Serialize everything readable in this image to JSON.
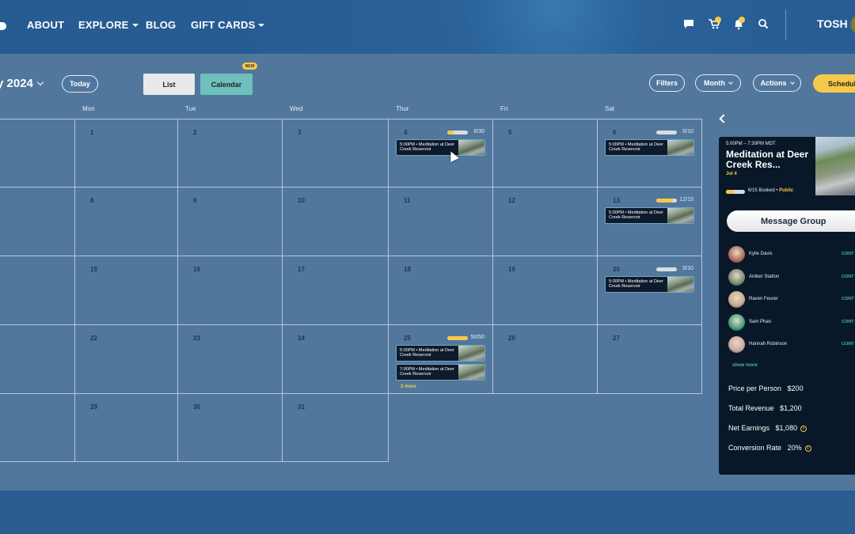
{
  "nav": {
    "items": [
      {
        "label": "ABOUT",
        "has_dropdown": false
      },
      {
        "label": "EXPLORE",
        "has_dropdown": true
      },
      {
        "label": "BLOG",
        "has_dropdown": false
      },
      {
        "label": "GIFT CARDS",
        "has_dropdown": true
      }
    ],
    "icons": [
      "chat-icon",
      "cart-icon",
      "bell-icon",
      "search-icon"
    ],
    "user_name": "TOSH"
  },
  "toolbar": {
    "month_label": "y 2024",
    "today_label": "Today",
    "list_label": "List",
    "calendar_label": "Calendar",
    "new_badge": "NEW",
    "filters_label": "Filters",
    "view_select": "Month",
    "actions_label": "Actions",
    "schedule_label": "Schedul"
  },
  "calendar": {
    "days_of_week": [
      "",
      "Mon",
      "Tue",
      "Wed",
      "Thur",
      "Fri",
      "Sat"
    ],
    "weeks": [
      [
        {
          "day": ""
        },
        {
          "day": "1"
        },
        {
          "day": "2"
        },
        {
          "day": "3"
        },
        {
          "day": "4",
          "capacity": "6/30",
          "fill": 0.2,
          "events": [
            "5:00PM • Meditation at Deer Creek Reservoir"
          ]
        },
        {
          "day": "5"
        },
        {
          "day": "6",
          "capacity": "0/10",
          "fill": 0,
          "events": [
            "5:00PM • Meditation at Deer Creek Reservoir"
          ]
        }
      ],
      [
        {
          "day": ""
        },
        {
          "day": "8"
        },
        {
          "day": "9"
        },
        {
          "day": "10"
        },
        {
          "day": "11"
        },
        {
          "day": "12"
        },
        {
          "day": "13",
          "capacity": "12/15",
          "fill": 0.8,
          "events": [
            "5:00PM • Meditation at Deer Creek Reservoir"
          ]
        }
      ],
      [
        {
          "day": ""
        },
        {
          "day": "15"
        },
        {
          "day": "16"
        },
        {
          "day": "17"
        },
        {
          "day": "18"
        },
        {
          "day": "19"
        },
        {
          "day": "20",
          "capacity": "0/10",
          "fill": 0,
          "events": [
            "5:00PM • Meditation at Deer Creek Reservoir"
          ]
        }
      ],
      [
        {
          "day": ""
        },
        {
          "day": "22"
        },
        {
          "day": "23"
        },
        {
          "day": "24"
        },
        {
          "day": "25",
          "capacity": "50/50",
          "fill": 1.0,
          "events": [
            "5:00PM • Meditation at Deer Creek Reservoir",
            "7:00PM • Meditation at Deer Creek Reservoir"
          ],
          "more": "2 more"
        },
        {
          "day": "26"
        },
        {
          "day": "27"
        }
      ],
      [
        {
          "day": ""
        },
        {
          "day": "29"
        },
        {
          "day": "30"
        },
        {
          "day": "31"
        }
      ]
    ]
  },
  "panel": {
    "time": "5:00PM – 7:30PM  MDT",
    "title": "Meditation at Deer Creek Res...",
    "date": "Jul 4",
    "booked": "6/15 Booked",
    "booked_fill": 0.4,
    "visibility": "Public",
    "message_button": "Message Group",
    "attendees": [
      {
        "name": "Kylie Davis",
        "action": "CONT",
        "color": "#b06a5a"
      },
      {
        "name": "Amber Statton",
        "action": "CONT",
        "color": "#7a8a70"
      },
      {
        "name": "Raven Feurer",
        "action": "CONT",
        "color": "#c9a890"
      },
      {
        "name": "Sam Phan",
        "action": "CONT",
        "color": "#3fa07a"
      },
      {
        "name": "Hannah Robinson",
        "action": "CONT",
        "color": "#c8a8a0"
      }
    ],
    "show_more": "show more",
    "stats": [
      {
        "label": "Price per Person",
        "value": "$200",
        "info": false
      },
      {
        "label": "Total Revenue",
        "value": "$1,200",
        "info": false
      },
      {
        "label": "Net Earnings",
        "value": "$1,080",
        "info": true
      },
      {
        "label": "Conversion Rate",
        "value": "20%",
        "info": true
      }
    ]
  },
  "colors": {
    "accent": "#f6c94a",
    "teal": "#6dc0bd",
    "background": "#51779d",
    "panel": "#091828"
  }
}
